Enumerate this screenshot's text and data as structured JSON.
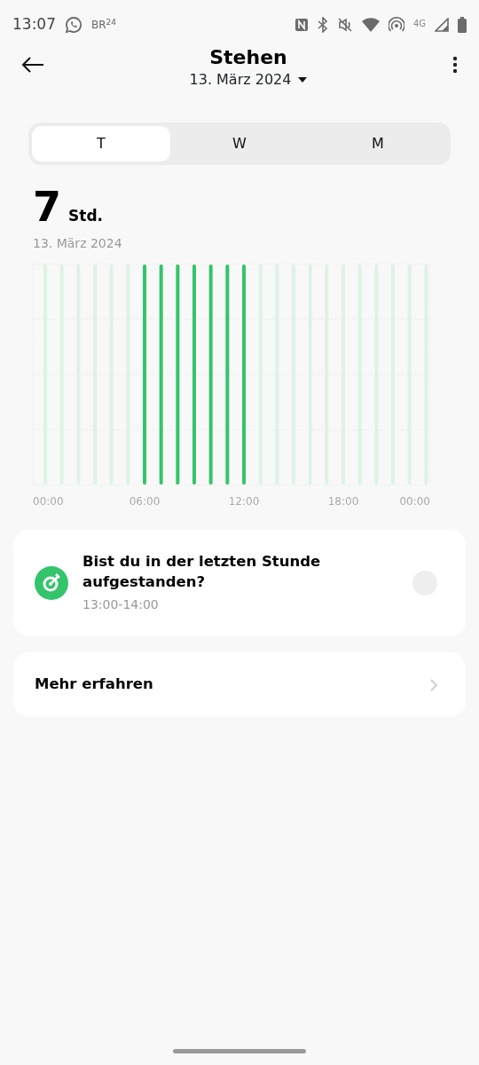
{
  "status_bar": {
    "time": "13:07",
    "logo": "BR$^{24}$",
    "network": "4G"
  },
  "header": {
    "title": "Stehen",
    "date": "13. März 2024"
  },
  "tabs": [
    {
      "label": "T",
      "selected": true
    },
    {
      "label": "W",
      "selected": false
    },
    {
      "label": "M",
      "selected": false
    }
  ],
  "summary": {
    "value": "7",
    "unit": "Std.",
    "date": "13. März 2024"
  },
  "hours": [
    {
      "stood": false
    },
    {
      "stood": false
    },
    {
      "stood": false
    },
    {
      "stood": false
    },
    {
      "stood": false
    },
    {
      "stood": false
    },
    {
      "stood": true
    },
    {
      "stood": true
    },
    {
      "stood": true
    },
    {
      "stood": true
    },
    {
      "stood": true
    },
    {
      "stood": true
    },
    {
      "stood": true
    },
    {
      "stood": false
    },
    {
      "stood": false
    },
    {
      "stood": false
    },
    {
      "stood": false
    },
    {
      "stood": false
    },
    {
      "stood": false
    },
    {
      "stood": false
    },
    {
      "stood": false
    },
    {
      "stood": false
    },
    {
      "stood": false
    },
    {
      "stood": false
    }
  ],
  "axis_labels": [
    "00:00",
    "06:00",
    "12:00",
    "18:00",
    "00:00"
  ],
  "reminder": {
    "title": "Bist du in der letzten Stunde aufgestanden?",
    "time": "13:00-14:00",
    "checked": false
  },
  "more": {
    "label": "Mehr erfahren"
  }
}
